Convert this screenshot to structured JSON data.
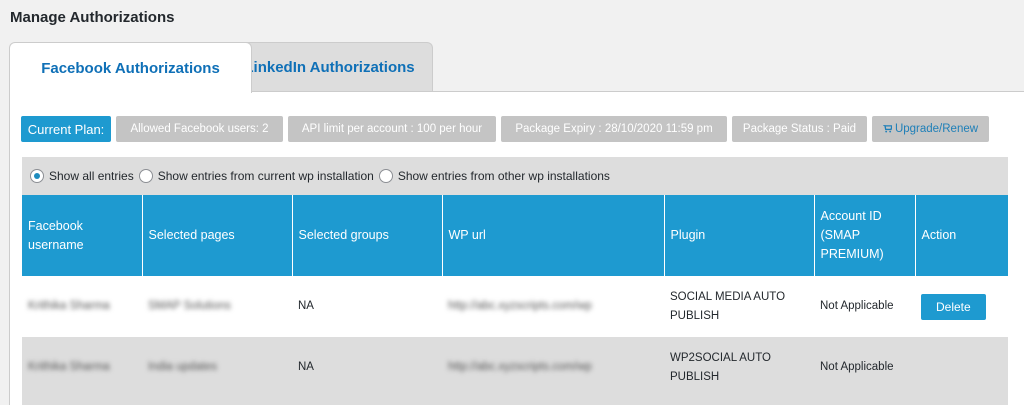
{
  "page": {
    "title": "Manage Authorizations"
  },
  "tabs": [
    {
      "label": "Facebook Authorizations",
      "active": true
    },
    {
      "label": "LinkedIn Authorizations",
      "active": false
    }
  ],
  "plan": {
    "current": "Current Plan:",
    "allowed_users": "Allowed Facebook users: 2",
    "api_limit": "API limit per account : 100 per hour",
    "expiry": "Package Expiry : 28/10/2020 11:59 pm",
    "status": "Package Status : Paid",
    "upgrade": "Upgrade/Renew",
    "upgrade_icon": "cart-icon"
  },
  "filters": {
    "options": [
      "Show all entries",
      "Show entries from current wp installation",
      "Show entries from other wp installations"
    ],
    "selected": 0
  },
  "table": {
    "headers": [
      "Facebook username",
      "Selected pages",
      "Selected groups",
      "WP url",
      "Plugin",
      "Account ID (SMAP PREMIUM)",
      "Action"
    ],
    "rows": [
      {
        "username": "Krithika Sharma",
        "pages": "SMAP Solutions",
        "groups": "NA",
        "wp_url": "http://abc.xyzscripts.com/wp",
        "plugin": "SOCIAL MEDIA AUTO PUBLISH",
        "account_id": "Not Applicable",
        "action": "Delete"
      },
      {
        "username": "Krithika Sharma",
        "pages": "India updates",
        "groups": "NA",
        "wp_url": "http://abc.xyzscripts.com/wp",
        "plugin": "WP2SOCIAL AUTO PUBLISH",
        "account_id": "Not Applicable",
        "action": ""
      }
    ]
  },
  "colors": {
    "accent": "#1e9ad0",
    "link": "#0f70b7",
    "muted": "#c4c4c4",
    "row_alt": "#dddddd"
  }
}
